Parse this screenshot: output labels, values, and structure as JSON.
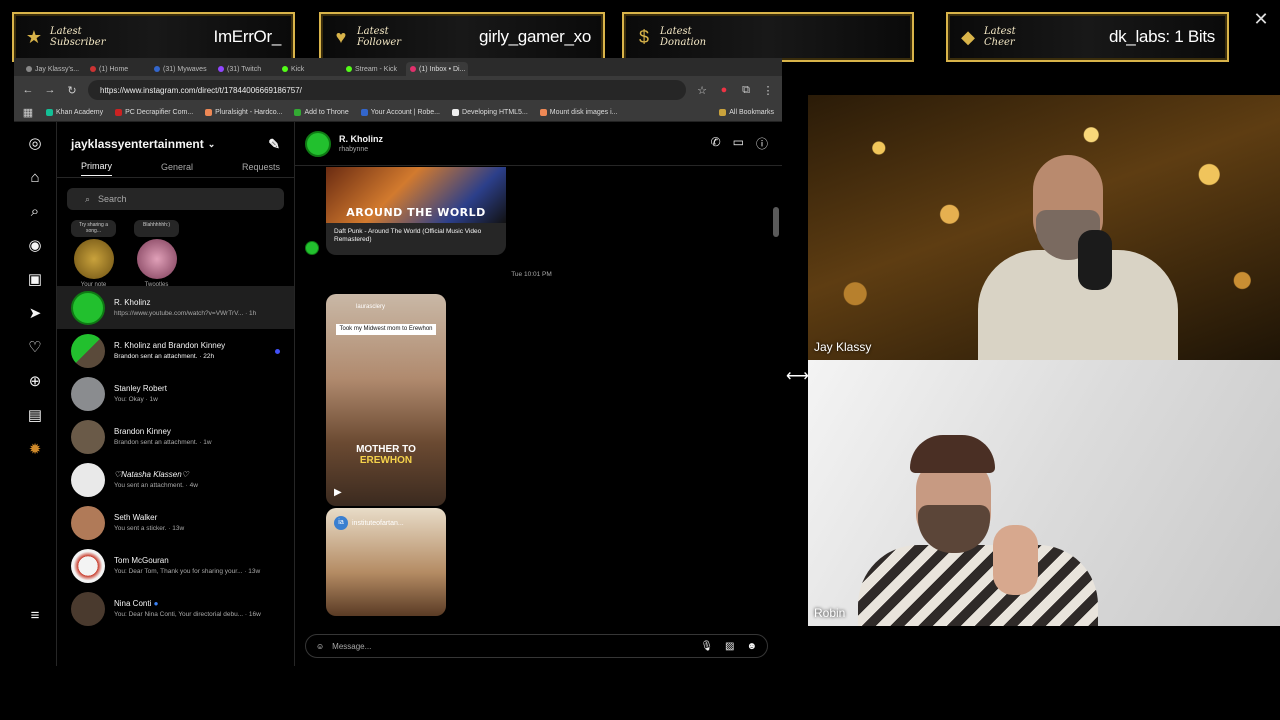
{
  "overlay": {
    "banners": [
      {
        "label": "Latest Subscriber",
        "value": "ImErrOr_",
        "icon": "star-icon"
      },
      {
        "label": "Latest Follower",
        "value": "girly_gamer_xo",
        "icon": "heart-icon"
      },
      {
        "label": "Latest Donation",
        "value": "",
        "icon": "dollar-icon"
      },
      {
        "label": "Latest Cheer",
        "value": "dk_labs: 1 Bits",
        "icon": "diamond-icon"
      }
    ],
    "close": "✕"
  },
  "browser": {
    "tabs": [
      "Jay Klassy's...",
      "(1) Home",
      "(31) Mywaves",
      "(31) Twitch",
      "Kick",
      "Stream - Kick",
      "(1) Inbox • Di..."
    ],
    "url": "https://www.instagram.com/direct/t/17844006669186757/",
    "bookmarks": [
      "Khan Academy",
      "PC Decrapifier Com...",
      "Pluralsight - Hardco...",
      "Add to Throne",
      "Your Account | Robe...",
      "Developing HTML5...",
      "Mount disk images i..."
    ],
    "all_bookmarks": "All Bookmarks"
  },
  "instagram": {
    "account": "jayklassyentertainment",
    "tabs": [
      "Primary",
      "General",
      "Requests"
    ],
    "search_placeholder": "Search",
    "notes": [
      {
        "bubble": "Try sharing a song...",
        "label": "Your note"
      },
      {
        "bubble": "Blahhhhhh:)",
        "label": "Twootles"
      }
    ],
    "threads": [
      {
        "name": "R. Kholinz",
        "preview": "https://www.youtube.com/watch?v=VWrTrV... · 1h",
        "selected": true,
        "unread": false
      },
      {
        "name": "R. Kholinz and Brandon Kinney",
        "preview": "Brandon sent an attachment. · 22h",
        "selected": false,
        "unread": true
      },
      {
        "name": "Stanley Robert",
        "preview": "You: Okay · 1w",
        "selected": false,
        "unread": false
      },
      {
        "name": "Brandon Kinney",
        "preview": "Brandon sent an attachment. · 1w",
        "selected": false,
        "unread": false
      },
      {
        "name": "♡Natasha Klassen♡",
        "preview": "You sent an attachment. · 4w",
        "selected": false,
        "unread": false
      },
      {
        "name": "Seth Walker",
        "preview": "You sent a sticker. · 13w",
        "selected": false,
        "unread": false
      },
      {
        "name": "Tom McGouran",
        "preview": "You: Dear Tom, Thank you for sharing your... · 13w",
        "selected": false,
        "unread": false
      },
      {
        "name": "Nina Conti",
        "preview": "You: Dear Nina Conti, Your directorial debu... · 16w",
        "selected": false,
        "unread": false
      }
    ],
    "chat": {
      "name": "R. Kholinz",
      "username": "rhabynne",
      "yt_thumb_text": "AROUND THE WORLD",
      "yt_caption": "Daft Punk - Around The World (Official Music Video Remastered)",
      "timestamp": "Tue 10:01 PM",
      "reel1_handle": "laurasclery",
      "reel1_caption": "Took my Midwest mom to Erewhon",
      "reel1_big_a": "MOTHER TO",
      "reel1_big_b": "EREWHON",
      "reel2_handle": "instituteofartan...",
      "message_placeholder": "Message..."
    }
  },
  "cams": [
    {
      "name": "Jay Klassy"
    },
    {
      "name": "Robin"
    }
  ],
  "colors": {
    "overlay_gold": "#d9b44a",
    "ig_bg": "#000000",
    "avatar_green": "#22c02e",
    "unread_blue": "#4150f7"
  }
}
